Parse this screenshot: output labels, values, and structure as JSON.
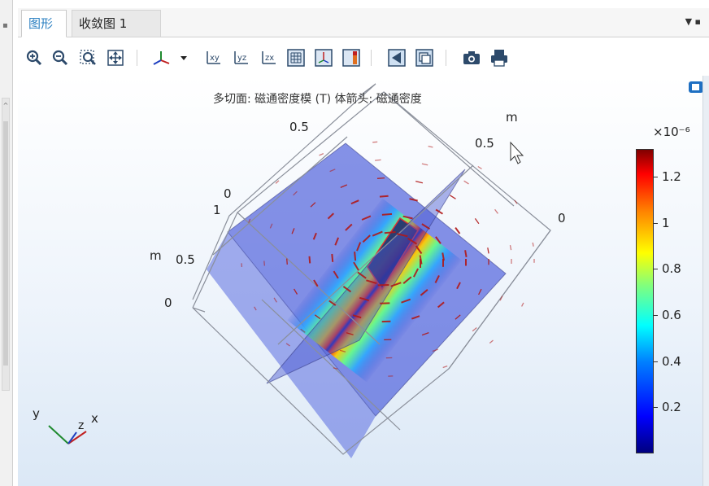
{
  "tabs": [
    {
      "label": "图形",
      "active": true
    },
    {
      "label": "收敛图 1",
      "active": false
    }
  ],
  "toolbar_icons": [
    "zoom-in-icon",
    "zoom-out-icon",
    "zoom-box-icon",
    "zoom-extents-icon",
    "axis-orientation-icon",
    "xy-plane-icon",
    "yz-plane-icon",
    "zx-plane-icon",
    "grid-icon",
    "axis-icon",
    "legend-icon",
    "transparency-icon",
    "wireframe-icon",
    "camera-icon",
    "print-icon"
  ],
  "plot": {
    "title": "多切面: 磁通密度模 (T)  体箭头: 磁通密度",
    "axis_labels": {
      "m_top": "m",
      "m_left": "m",
      "t05_top_left": "0.5",
      "t05_top_right": "0.5",
      "t0_top": "0",
      "t1_left": "1",
      "t05_left": "0.5",
      "t0_left": "0",
      "t0_right": "0"
    },
    "triad": {
      "x": "x",
      "y": "y",
      "z": "z"
    }
  },
  "colorbar": {
    "exponent": "×10⁻⁶",
    "ticks": [
      "1.2",
      "1",
      "0.8",
      "0.6",
      "0.4",
      "0.2"
    ],
    "tick_values": [
      1.2,
      1.0,
      0.8,
      0.6,
      0.4,
      0.2
    ],
    "min": 0.0,
    "max": 1.32,
    "colormap": "rainbow"
  },
  "colors": {
    "accent": "#2a7fc1",
    "slice": "#3c4fd8",
    "arrow": "#b01818"
  }
}
